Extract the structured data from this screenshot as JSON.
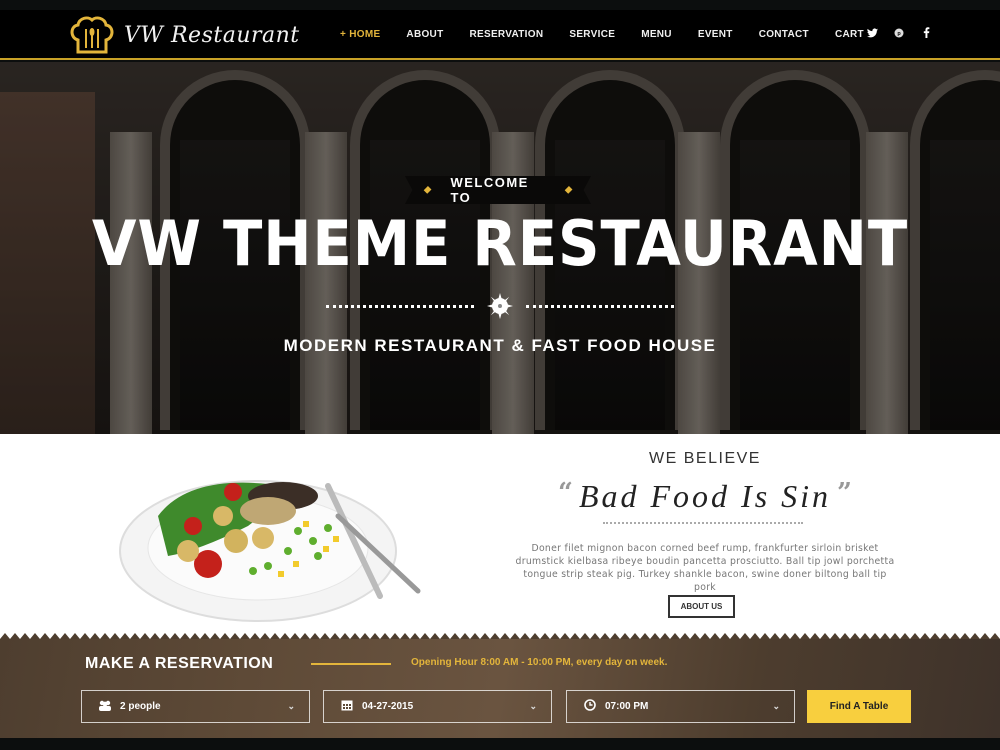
{
  "colors": {
    "accent": "#e3b53b",
    "button": "#f8cf3e",
    "header_bg": "#000000"
  },
  "header": {
    "logo_icon": "chef-hat-icon",
    "logo_text": "VW Restaurant",
    "nav": [
      {
        "label": "+ HOME",
        "active": true
      },
      {
        "label": "ABOUT"
      },
      {
        "label": "RESERVATION"
      },
      {
        "label": "SERVICE"
      },
      {
        "label": "MENU"
      },
      {
        "label": "EVENT"
      },
      {
        "label": "CONTACT"
      },
      {
        "label": "CART"
      }
    ],
    "social": [
      {
        "icon": "twitter-icon",
        "glyph": "t"
      },
      {
        "icon": "pinterest-icon",
        "glyph": "p"
      },
      {
        "icon": "facebook-icon",
        "glyph": "f"
      }
    ]
  },
  "hero": {
    "welcome": "WELCOME TO",
    "title": "VW THEME RESTAURANT",
    "subtitle": "MODERN RESTAURANT & FAST FOOD HOUSE"
  },
  "about": {
    "heading": "WE BELIEVE",
    "quote_open": "“",
    "quote": "Bad Food Is Sin",
    "quote_close": "”",
    "body": "Doner filet mignon bacon corned beef rump, frankfurter sirloin brisket drumstick kielbasa ribeye boudin pancetta prosciutto. Ball tip jowl porchetta tongue strip steak pig. Turkey shankle bacon, swine doner biltong ball tip pork",
    "button": "ABOUT US"
  },
  "reservation": {
    "title": "MAKE A RESERVATION",
    "hours": "Opening Hour 8:00 AM - 10:00 PM, every day on week.",
    "people": {
      "value": "2 people",
      "icon": "people-icon"
    },
    "date": {
      "value": "04-27-2015",
      "icon": "calendar-icon"
    },
    "time": {
      "value": "07:00 PM",
      "icon": "clock-icon"
    },
    "button": "Find A Table"
  }
}
